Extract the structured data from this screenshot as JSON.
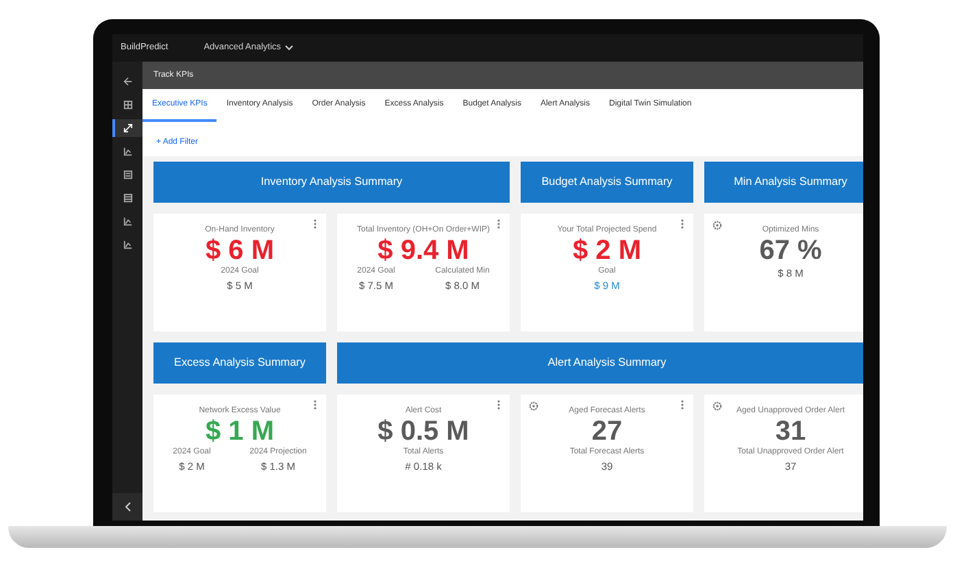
{
  "app": {
    "brand": "BuildPredict",
    "menu": "Advanced Analytics"
  },
  "sidebar": {
    "items": [
      {
        "selected": false
      },
      {
        "selected": false
      },
      {
        "selected": true
      },
      {
        "selected": false
      },
      {
        "selected": false
      },
      {
        "selected": false
      },
      {
        "selected": false
      },
      {
        "selected": false
      }
    ]
  },
  "page_title": "Track KPIs",
  "tabs": [
    {
      "label": "Executive KPIs",
      "selected": true
    },
    {
      "label": "Inventory Analysis",
      "selected": false
    },
    {
      "label": "Order Analysis",
      "selected": false
    },
    {
      "label": "Excess Analysis",
      "selected": false
    },
    {
      "label": "Budget Analysis",
      "selected": false
    },
    {
      "label": "Alert Analysis",
      "selected": false
    },
    {
      "label": "Digital Twin Simulation",
      "selected": false
    }
  ],
  "filter_link": "+ Add Filter",
  "rows": [
    {
      "sections": [
        {
          "title": "Inventory Analysis Summary",
          "cards": [
            {
              "label": "On-Hand Inventory",
              "value": "$ 6 M",
              "color": "#e8222e",
              "menu": true,
              "settings": false,
              "details": [
                {
                  "label": "2024 Goal",
                  "value": "$ 5 M",
                  "color": "#555555"
                }
              ]
            },
            {
              "label": "Total Inventory (OH+On Order+WIP)",
              "value": "$ 9.4 M",
              "color": "#e8222e",
              "menu": true,
              "settings": false,
              "details": [
                {
                  "label": "2024 Goal",
                  "value": "$ 7.5 M",
                  "color": "#555555"
                },
                {
                  "label": "Calculated Min",
                  "value": "$ 8.0 M",
                  "color": "#555555"
                }
              ]
            }
          ]
        },
        {
          "title": "Budget Analysis Summary",
          "cards": [
            {
              "label": "Your Total Projected Spend",
              "value": "$ 2 M",
              "color": "#e8222e",
              "menu": true,
              "settings": false,
              "details": [
                {
                  "label": "Goal",
                  "value": "$ 9 M",
                  "color": "#2a8bd6"
                }
              ]
            }
          ]
        },
        {
          "title": "Min Analysis Summary",
          "cards": [
            {
              "label": "Optimized Mins",
              "value": "67 %",
              "color": "#5a5a5a",
              "settings": true,
              "details": [
                {
                  "value": "$ 8 M",
                  "color": "#555555"
                }
              ]
            }
          ]
        }
      ]
    },
    {
      "sections": [
        {
          "title": "Excess Analysis Summary",
          "cards": [
            {
              "label": "Network Excess Value",
              "value": "$ 1 M",
              "color": "#36a852",
              "menu": true,
              "settings": false,
              "details": [
                {
                  "label": "2024 Goal",
                  "value": "$ 2 M",
                  "color": "#555555"
                },
                {
                  "label": "2024 Projection",
                  "value": "$ 1.3 M",
                  "color": "#555555"
                }
              ]
            }
          ]
        },
        {
          "title": "Alert Analysis Summary",
          "cards": [
            {
              "label": "Alert Cost",
              "value": "$ 0.5 M",
              "color": "#5a5a5a",
              "menu": true,
              "settings": false,
              "details": [
                {
                  "label": "Total Alerts",
                  "value": "# 0.18 k",
                  "color": "#555555"
                }
              ]
            },
            {
              "label": "Aged Forecast Alerts",
              "value": "27",
              "color": "#5a5a5a",
              "menu": true,
              "settings": true,
              "details": [
                {
                  "label": "Total Forecast Alerts",
                  "value": "39",
                  "color": "#555555"
                }
              ]
            },
            {
              "label": "Aged Unapproved Order Alert",
              "value": "31",
              "color": "#5a5a5a",
              "settings": true,
              "details": [
                {
                  "label": "Total Unapproved Order Alert",
                  "value": "37",
                  "color": "#555555"
                }
              ]
            }
          ]
        }
      ]
    }
  ]
}
